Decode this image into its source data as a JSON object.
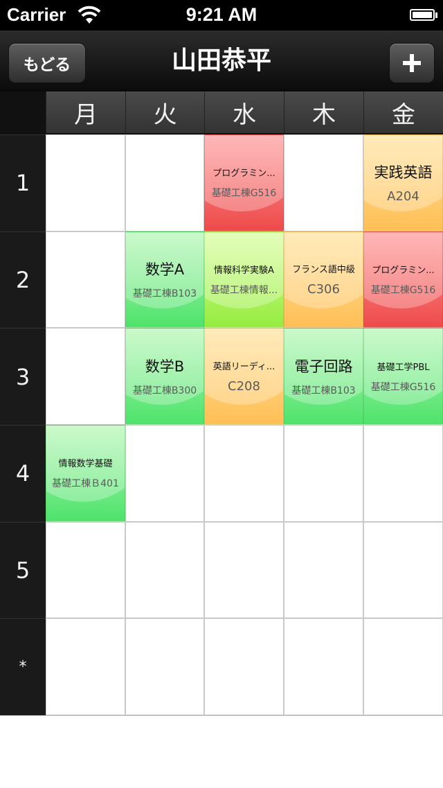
{
  "status_bar": {
    "carrier": "Carrier",
    "time": "9:21 AM"
  },
  "nav": {
    "back_label": "もどる",
    "title": "山田恭平",
    "add_icon": "plus-icon"
  },
  "days": [
    "月",
    "火",
    "水",
    "木",
    "金"
  ],
  "periods": [
    "1",
    "2",
    "3",
    "4",
    "5",
    "*"
  ],
  "courses": [
    {
      "name": "プログラミン...",
      "room": "基礎工棟G516",
      "period": 1,
      "day": 3,
      "color": "red"
    },
    {
      "name": "実践英語",
      "room": "A204",
      "period": 1,
      "day": 5,
      "color": "orange"
    },
    {
      "name": "数学A",
      "room": "基礎工棟B103",
      "period": 2,
      "day": 2,
      "color": "green"
    },
    {
      "name": "情報科学実験A",
      "room": "基礎工棟情報...",
      "period": 2,
      "day": 3,
      "color": "lime"
    },
    {
      "name": "フランス語中級",
      "room": "C306",
      "period": 2,
      "day": 4,
      "color": "orange"
    },
    {
      "name": "プログラミン...",
      "room": "基礎工棟G516",
      "period": 2,
      "day": 5,
      "color": "red"
    },
    {
      "name": "数学B",
      "room": "基礎工棟B300",
      "period": 3,
      "day": 2,
      "color": "green"
    },
    {
      "name": "英語リーディ...",
      "room": "C208",
      "period": 3,
      "day": 3,
      "color": "orange"
    },
    {
      "name": "電子回路",
      "room": "基礎工棟B103",
      "period": 3,
      "day": 4,
      "color": "green"
    },
    {
      "name": "基礎工学PBL",
      "room": "基礎工棟G516",
      "period": 3,
      "day": 5,
      "color": "green"
    },
    {
      "name": "情報数学基礎",
      "room": "基礎工棟Ｂ401",
      "period": 4,
      "day": 1,
      "color": "green"
    }
  ],
  "colors": {
    "red": "#ee4a4a",
    "orange": "#ffbf55",
    "green": "#4ee36b",
    "lime": "#96ec3f",
    "nav_dark": "#111111"
  }
}
